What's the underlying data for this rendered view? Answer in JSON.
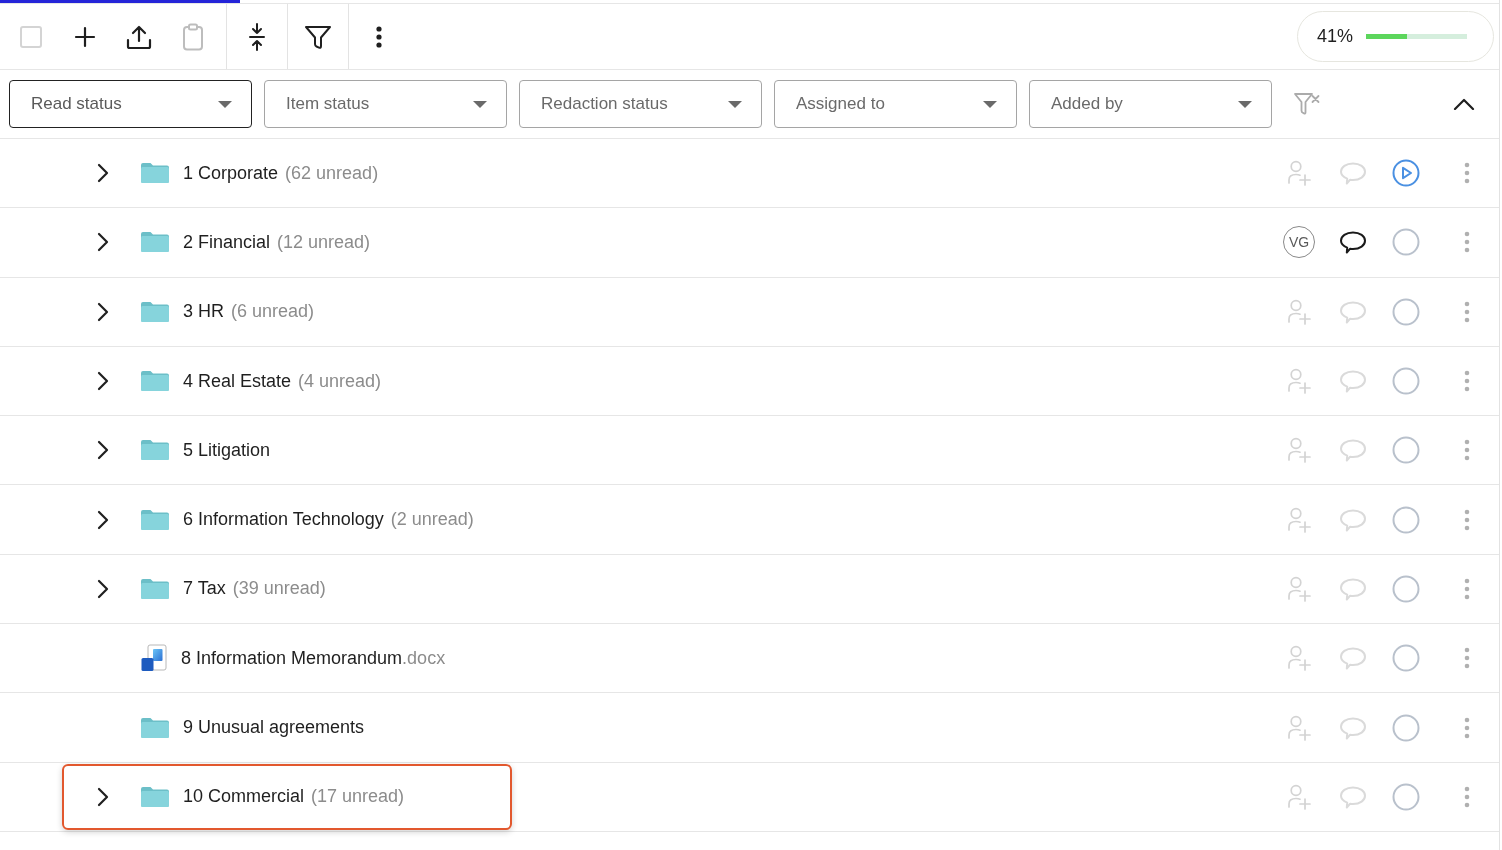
{
  "loading_bar": {
    "level": 0.16
  },
  "toolbar": {
    "groups": [
      {
        "items": [
          {
            "kind": "checkbox",
            "checked": false,
            "disabled": false
          },
          {
            "kind": "add",
            "disabled": false
          },
          {
            "kind": "upload",
            "disabled": false
          },
          {
            "kind": "paste",
            "disabled": true
          }
        ]
      },
      {
        "items": [
          {
            "kind": "collapse",
            "disabled": false
          }
        ]
      },
      {
        "items": [
          {
            "kind": "filter",
            "disabled": false
          }
        ]
      },
      {
        "items": [
          {
            "kind": "more",
            "disabled": false
          }
        ]
      }
    ],
    "progress": {
      "label": "41%",
      "level": 0.41
    }
  },
  "filters": {
    "dropdowns": [
      {
        "label": "Read status",
        "focused": true
      },
      {
        "label": "Item status",
        "focused": false
      },
      {
        "label": "Redaction status",
        "focused": false
      },
      {
        "label": "Assigned to",
        "focused": false
      },
      {
        "label": "Added by",
        "focused": false
      }
    ],
    "clear_filters": {
      "disabled": true
    },
    "panel": {
      "expanded": true
    }
  },
  "rows": [
    {
      "kind": "folder",
      "name": "1 Corporate",
      "unread": "(62 unread)",
      "expandable": true,
      "expanded": false,
      "has_comments": false,
      "in_progress": true,
      "highlighted": false
    },
    {
      "kind": "folder",
      "name": "2 Financial",
      "unread": "(12 unread)",
      "expandable": true,
      "expanded": false,
      "assignee": "VG",
      "has_comments": true,
      "in_progress": false,
      "highlighted": false
    },
    {
      "kind": "folder",
      "name": "3 HR",
      "unread": "(6 unread)",
      "expandable": true,
      "expanded": false,
      "has_comments": false,
      "in_progress": false,
      "highlighted": false
    },
    {
      "kind": "folder",
      "name": "4 Real Estate",
      "unread": "(4 unread)",
      "expandable": true,
      "expanded": false,
      "has_comments": false,
      "in_progress": false,
      "highlighted": false
    },
    {
      "kind": "folder",
      "name": "5 Litigation",
      "expandable": true,
      "expanded": false,
      "has_comments": false,
      "in_progress": false,
      "highlighted": false
    },
    {
      "kind": "folder",
      "name": "6 Information Technology",
      "unread": "(2 unread)",
      "expandable": true,
      "expanded": false,
      "has_comments": false,
      "in_progress": false,
      "highlighted": false
    },
    {
      "kind": "folder",
      "name": "7 Tax",
      "unread": "(39 unread)",
      "expandable": true,
      "expanded": false,
      "has_comments": false,
      "in_progress": false,
      "highlighted": false
    },
    {
      "kind": "file",
      "name": "8 Information Memorandum",
      "extension": ".docx",
      "expandable": false,
      "has_comments": false,
      "in_progress": false,
      "highlighted": false
    },
    {
      "kind": "folder",
      "name": "9 Unusual agreements",
      "expandable": false,
      "has_comments": false,
      "in_progress": false,
      "highlighted": false
    },
    {
      "kind": "folder",
      "name": "10 Commercial",
      "unread": "(17 unread)",
      "expandable": true,
      "expanded": false,
      "has_comments": false,
      "in_progress": false,
      "highlighted": true
    }
  ]
}
